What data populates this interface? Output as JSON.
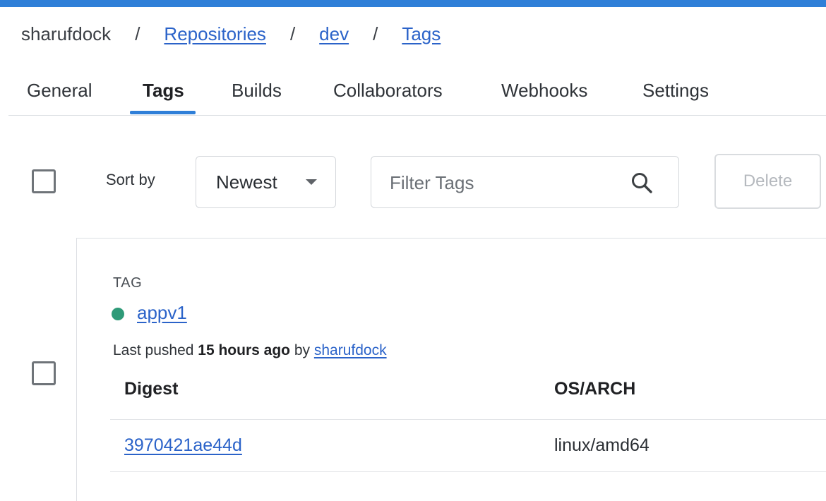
{
  "colors": {
    "accent": "#2f7fd8",
    "link": "#2b63c9",
    "status_active": "#2e9a78"
  },
  "breadcrumb": {
    "owner": "sharufdock",
    "separator": "/",
    "items": [
      {
        "label": "Repositories"
      },
      {
        "label": "dev"
      },
      {
        "label": "Tags"
      }
    ]
  },
  "tabs": [
    {
      "label": "General",
      "active": false
    },
    {
      "label": "Tags",
      "active": true
    },
    {
      "label": "Builds",
      "active": false
    },
    {
      "label": "Collaborators",
      "active": false
    },
    {
      "label": "Webhooks",
      "active": false
    },
    {
      "label": "Settings",
      "active": false
    }
  ],
  "toolbar": {
    "sort_label": "Sort by",
    "sort_value": "Newest",
    "filter_placeholder": "Filter Tags",
    "delete_label": "Delete",
    "icons": {
      "search": "search-icon",
      "dropdown": "chevron-down-icon"
    }
  },
  "tag_card": {
    "heading": "TAG",
    "tag_name": "appv1",
    "pushed_prefix": "Last pushed",
    "pushed_time": "15 hours ago",
    "pushed_by_word": "by",
    "pushed_by": "sharufdock",
    "table": {
      "columns": [
        "Digest",
        "OS/ARCH"
      ],
      "rows": [
        {
          "digest": "3970421ae44d",
          "os_arch": "linux/amd64"
        }
      ]
    }
  }
}
